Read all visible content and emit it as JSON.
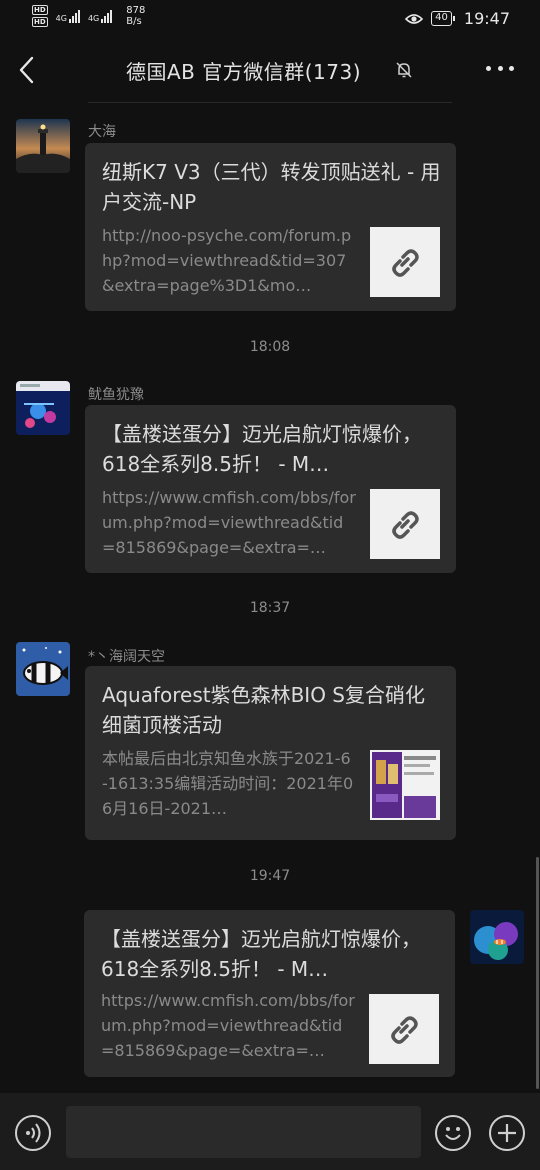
{
  "status_bar": {
    "hd1": "HD",
    "hd2": "HD",
    "net1": "4G",
    "net2": "4G",
    "speed_value": "878",
    "speed_unit": "B/s",
    "battery": "40",
    "time": "19:47"
  },
  "header": {
    "title": "德国AB  官方微信群(173)"
  },
  "messages": [
    {
      "sender": "大海",
      "title": "纽斯K7 V3（三代）转发顶贴送礼 - 用户交流-NP",
      "desc": "http://noo-psyche.com/forum.php?mod=viewthread&tid=307&extra=page%3D1&mo…",
      "thumb": "link-icon"
    },
    {
      "timestamp": "18:08"
    },
    {
      "sender": "鱿鱼犹豫",
      "title": "【盖楼送蛋分】迈光启航灯惊爆价，618全系列8.5折！ - M…",
      "desc": "https://www.cmfish.com/bbs/forum.php?mod=viewthread&tid=815869&page=&extra=…",
      "thumb": "link-icon"
    },
    {
      "timestamp": "18:37"
    },
    {
      "sender": "*丶海阔天空",
      "title": "Aquaforest紫色森林BIO S复合硝化细菌顶楼活动",
      "desc": "本帖最后由北京知鱼水族于2021-6-1613:35编辑活动时间：2021年06月16日-2021…",
      "thumb": "product-image"
    },
    {
      "timestamp": "19:47"
    },
    {
      "title": "【盖楼送蛋分】迈光启航灯惊爆价，618全系列8.5折！ - M…",
      "desc": "https://www.cmfish.com/bbs/forum.php?mod=viewthread&tid=815869&page=&extra=…",
      "thumb": "link-icon",
      "self": true
    }
  ]
}
